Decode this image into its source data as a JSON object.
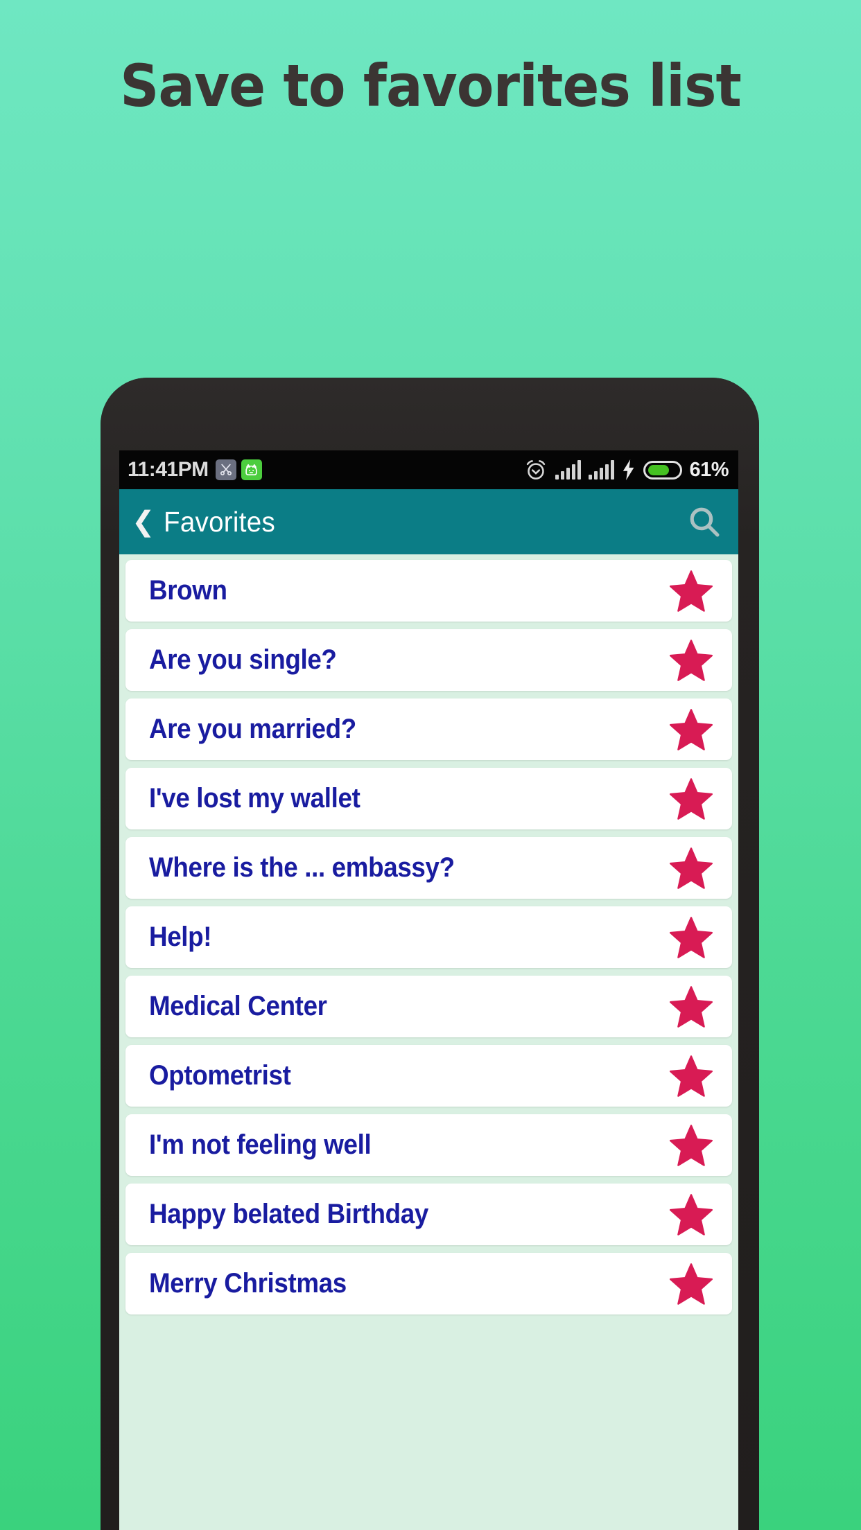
{
  "headline": "Save to favorites list",
  "theme": {
    "background_top": "#6fe7c2",
    "background_bottom": "#3ad27d",
    "headline_color": "#3b3533",
    "phone_frame": "#262322",
    "actionbar_color": "#0b7d86",
    "list_background": "#d9f0e2",
    "row_background": "#ffffff",
    "row_text_color": "#191ca0",
    "star_color": "#d81b54",
    "battery_fill": "#45c122"
  },
  "statusbar": {
    "time": "11:41PM",
    "left_icons": [
      {
        "name": "scissors-icon",
        "glyph": "✂",
        "background": "#6b6f80"
      },
      {
        "name": "android-cat-icon",
        "glyph": "ὃ1",
        "background": "#4ccd3e"
      }
    ],
    "right_icons": [
      {
        "name": "alarm-clock-icon"
      },
      {
        "name": "signal-bars-sim1-icon"
      },
      {
        "name": "signal-bars-sim2-icon"
      },
      {
        "name": "charging-bolt-icon"
      },
      {
        "name": "battery-icon"
      }
    ],
    "battery_percent": "61%",
    "battery_level": 61
  },
  "actionbar": {
    "back_label": "❮",
    "title": "Favorites",
    "search_icon": "search-icon"
  },
  "list": {
    "items": [
      {
        "label": "Brown",
        "favorite": true
      },
      {
        "label": "Are you single?",
        "favorite": true
      },
      {
        "label": "Are you married?",
        "favorite": true
      },
      {
        "label": "I've lost my wallet",
        "favorite": true
      },
      {
        "label": "Where is the ... embassy?",
        "favorite": true
      },
      {
        "label": "Help!",
        "favorite": true
      },
      {
        "label": "Medical Center",
        "favorite": true
      },
      {
        "label": "Optometrist",
        "favorite": true
      },
      {
        "label": "I'm not feeling well",
        "favorite": true
      },
      {
        "label": "Happy belated Birthday",
        "favorite": true
      },
      {
        "label": "Merry Christmas",
        "favorite": true
      }
    ]
  }
}
